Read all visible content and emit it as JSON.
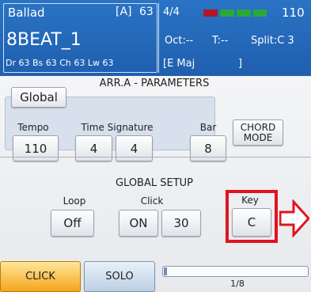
{
  "header": {
    "style_name": "Ballad",
    "variation": "[A]",
    "tempo_display": "63",
    "song_name": "8BEAT_1",
    "mixer_line": "Dr 63   Bs 63  Ch 63  Lw 63",
    "time_sig": "4/4",
    "bpm": "110",
    "octave": "Oct:--",
    "transpose": "T:--",
    "split": "Split:C 3",
    "chord": "[E Maj",
    "chord_close": "]",
    "beat_leds": [
      "#b0182a",
      "#2aa83c",
      "#2aa83c",
      "#2aa83c"
    ]
  },
  "arr": {
    "title": "ARR.A - PARAMETERS",
    "global_tab": "Global",
    "tempo_label": "Tempo",
    "tempo_value": "110",
    "timesig_label": "Time Signature",
    "timesig_num": "4",
    "timesig_den": "4",
    "bar_label": "Bar",
    "bar_value": "8",
    "chord_mode_label": "CHORD\nMODE"
  },
  "global_setup": {
    "title": "GLOBAL SETUP",
    "loop_label": "Loop",
    "loop_value": "Off",
    "click_label": "Click",
    "click_on": "ON",
    "click_value": "30",
    "key_label": "Key",
    "key_value": "C"
  },
  "tabs": {
    "click": "CLICK",
    "solo": "SOLO"
  },
  "progress": {
    "fraction": 0.02,
    "label": "1/8"
  },
  "colors": {
    "highlight": "#e0141e",
    "header_bg": "#2a73c5"
  }
}
